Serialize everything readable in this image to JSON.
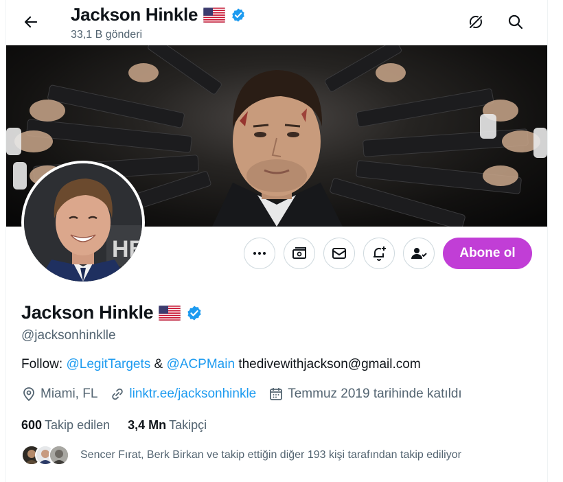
{
  "header": {
    "title": "Jackson Hinkle",
    "post_count": "33,1 B gönderi"
  },
  "actions": {
    "subscribe_label": "Abone ol"
  },
  "profile": {
    "name": "Jackson Hinkle",
    "handle": "@jacksonhinklle",
    "bio": {
      "prefix": "Follow: ",
      "mention1": "@LegitTargets",
      "amp": " & ",
      "mention2": "@ACPMain",
      "email": " thedivewithjackson@gmail.com"
    },
    "location": "Miami, FL",
    "website": "linktr.ee/jacksonhinkle",
    "joined": "Temmuz 2019 tarihinde katıldı",
    "following_count": "600",
    "following_label": "Takip edilen",
    "followers_count": "3,4 Mn",
    "followers_label": "Takipçi",
    "followed_by": "Sencer Fırat, Berk Birkan ve takip ettiğin diğer 193 kişi tarafından takip ediliyor"
  },
  "colors": {
    "accent": "#c13ed6",
    "link": "#1d9bf0",
    "verified": "#1d9bf0",
    "muted": "#536471"
  }
}
